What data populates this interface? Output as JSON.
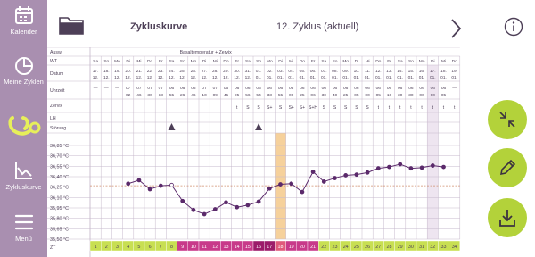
{
  "sidebar": {
    "items": [
      {
        "label": "Kalender",
        "icon": "calendar-icon"
      },
      {
        "label": "Meine Zyklen",
        "icon": "pie-chart-icon"
      },
      {
        "label": "",
        "icon": "stethoscope-icon"
      },
      {
        "label": "Zykluskurve",
        "icon": "line-chart-icon"
      },
      {
        "label": "Menü",
        "icon": "menu-icon"
      }
    ]
  },
  "header": {
    "title": "Zykluskurve",
    "cycle": "12. Zyklus (aktuell)"
  },
  "actions": [
    {
      "name": "collapse-button",
      "icon": "compress-icon"
    },
    {
      "name": "edit-button",
      "icon": "pencil-icon"
    },
    {
      "name": "download-button",
      "icon": "download-icon"
    }
  ],
  "colors": {
    "sidebar": "#a98fb0",
    "accent_green": "#b3d23a",
    "curve": "#5b2a6b",
    "period": "#c83a8a",
    "period_dark": "#9c1c6a",
    "ovulation": "#f4c98a",
    "cover_line": "#d08f6f"
  },
  "chart_data": {
    "type": "line",
    "row_labels": {
      "ausw": "Ausw.",
      "wt": "WT",
      "datum": "Datum",
      "uhrzeit": "Uhrzeit",
      "zervix": "Zervix",
      "lh": "LH",
      "stoerung": "Störung",
      "zt": "ZT"
    },
    "method_label": "Basaltemperatur + Zervix",
    "weekdays": [
      "Sa",
      "So",
      "Mo",
      "Di",
      "Mi",
      "Do",
      "Fr",
      "Sa",
      "So",
      "Mo",
      "Di",
      "Mi",
      "Do",
      "Fr",
      "Sa",
      "So",
      "Mo",
      "Di",
      "Mi",
      "Do",
      "Fr",
      "Sa",
      "So",
      "Mo",
      "Di",
      "Mi",
      "Do",
      "Fr",
      "Sa",
      "So",
      "Mo",
      "Di",
      "Mi",
      "Do"
    ],
    "date_day": [
      "17.",
      "18.",
      "19.",
      "20.",
      "21.",
      "22.",
      "23.",
      "24.",
      "25.",
      "26.",
      "27.",
      "28.",
      "29.",
      "30.",
      "31.",
      "01.",
      "02.",
      "03.",
      "04.",
      "05.",
      "06.",
      "07.",
      "08.",
      "09.",
      "10.",
      "11.",
      "12.",
      "13.",
      "14.",
      "15.",
      "16.",
      "17.",
      "18.",
      "19."
    ],
    "date_month": [
      "12.",
      "12.",
      "12.",
      "12.",
      "12.",
      "12.",
      "12.",
      "12.",
      "12.",
      "12.",
      "12.",
      "12.",
      "12.",
      "12.",
      "12.",
      "01.",
      "01.",
      "01.",
      "01.",
      "01.",
      "01.",
      "01.",
      "01.",
      "01.",
      "01.",
      "01.",
      "01.",
      "01.",
      "01.",
      "01.",
      "01.",
      "01.",
      "01.",
      "01."
    ],
    "time_hour": [
      "—",
      "—",
      "—",
      "07",
      "07",
      "07",
      "07",
      "06",
      "06",
      "06",
      "07",
      "07",
      "06",
      "06",
      "06",
      "06",
      "06",
      "06",
      "06",
      "06",
      "06",
      "06",
      "06",
      "06",
      "06",
      "06",
      "06",
      "06",
      "06",
      "06",
      "06",
      "06",
      "06",
      "—"
    ],
    "time_min": [
      "—",
      "—",
      "—",
      "02",
      "46",
      "30",
      "13",
      "55",
      "26",
      "46",
      "10",
      "09",
      "45",
      "25",
      "56",
      "54",
      "33",
      "55",
      "00",
      "25",
      "06",
      "30",
      "40",
      "25",
      "05",
      "00",
      "05",
      "10",
      "30",
      "30",
      "00",
      "00",
      "05",
      "—"
    ],
    "zervix": [
      "",
      "",
      "",
      "",
      "",
      "",
      "",
      "",
      "t",
      "S",
      "S",
      "S+",
      "S",
      "S+",
      "S+",
      "S",
      "S",
      "S",
      "S",
      "S",
      "t",
      "t",
      "t",
      "t",
      "t",
      "t",
      "t",
      "t",
      "t",
      "",
      "",
      "",
      "",
      ""
    ],
    "zervix_shown": [
      "t",
      "S",
      "S",
      "S+",
      "S",
      "S+",
      "S+",
      "S+H",
      "S",
      "S",
      "S",
      "S",
      "S",
      "t",
      "t",
      "t",
      "t",
      "t",
      "t",
      "t",
      "t"
    ],
    "disturbance_days": [
      8,
      16
    ],
    "y_labels": [
      "36,85 °C",
      "36,70 °C",
      "36,55 °C",
      "36,40 °C",
      "36,25 °C",
      "36,10 °C",
      "35,95 °C",
      "35,80 °C",
      "35,65 °C",
      "35,50 °C"
    ],
    "ylim": [
      35.5,
      36.85
    ],
    "cycle_days": [
      1,
      2,
      3,
      4,
      5,
      6,
      7,
      8,
      9,
      10,
      11,
      12,
      13,
      14,
      15,
      16,
      17,
      18,
      19,
      20,
      21,
      22,
      23,
      24,
      25,
      26,
      27,
      28,
      29,
      30,
      31,
      32,
      33,
      34
    ],
    "period_days": [
      9,
      10,
      11,
      12,
      13,
      14,
      15,
      16,
      17,
      18,
      19,
      20,
      21
    ],
    "period_dark_days": [
      16,
      17,
      18
    ],
    "ovulation_day": 18,
    "cover_line_temp": 36.27,
    "temperatures": [
      null,
      null,
      null,
      36.3,
      36.35,
      36.22,
      36.27,
      36.28,
      36.05,
      35.92,
      35.86,
      35.93,
      36.03,
      35.96,
      35.99,
      36.04,
      36.23,
      36.29,
      36.3,
      36.18,
      36.47,
      36.33,
      36.38,
      36.42,
      36.43,
      36.46,
      36.52,
      36.54,
      36.58,
      36.52,
      36.53,
      36.56,
      36.54,
      null
    ],
    "open_points": [
      8
    ],
    "last_chart_day": 33
  }
}
